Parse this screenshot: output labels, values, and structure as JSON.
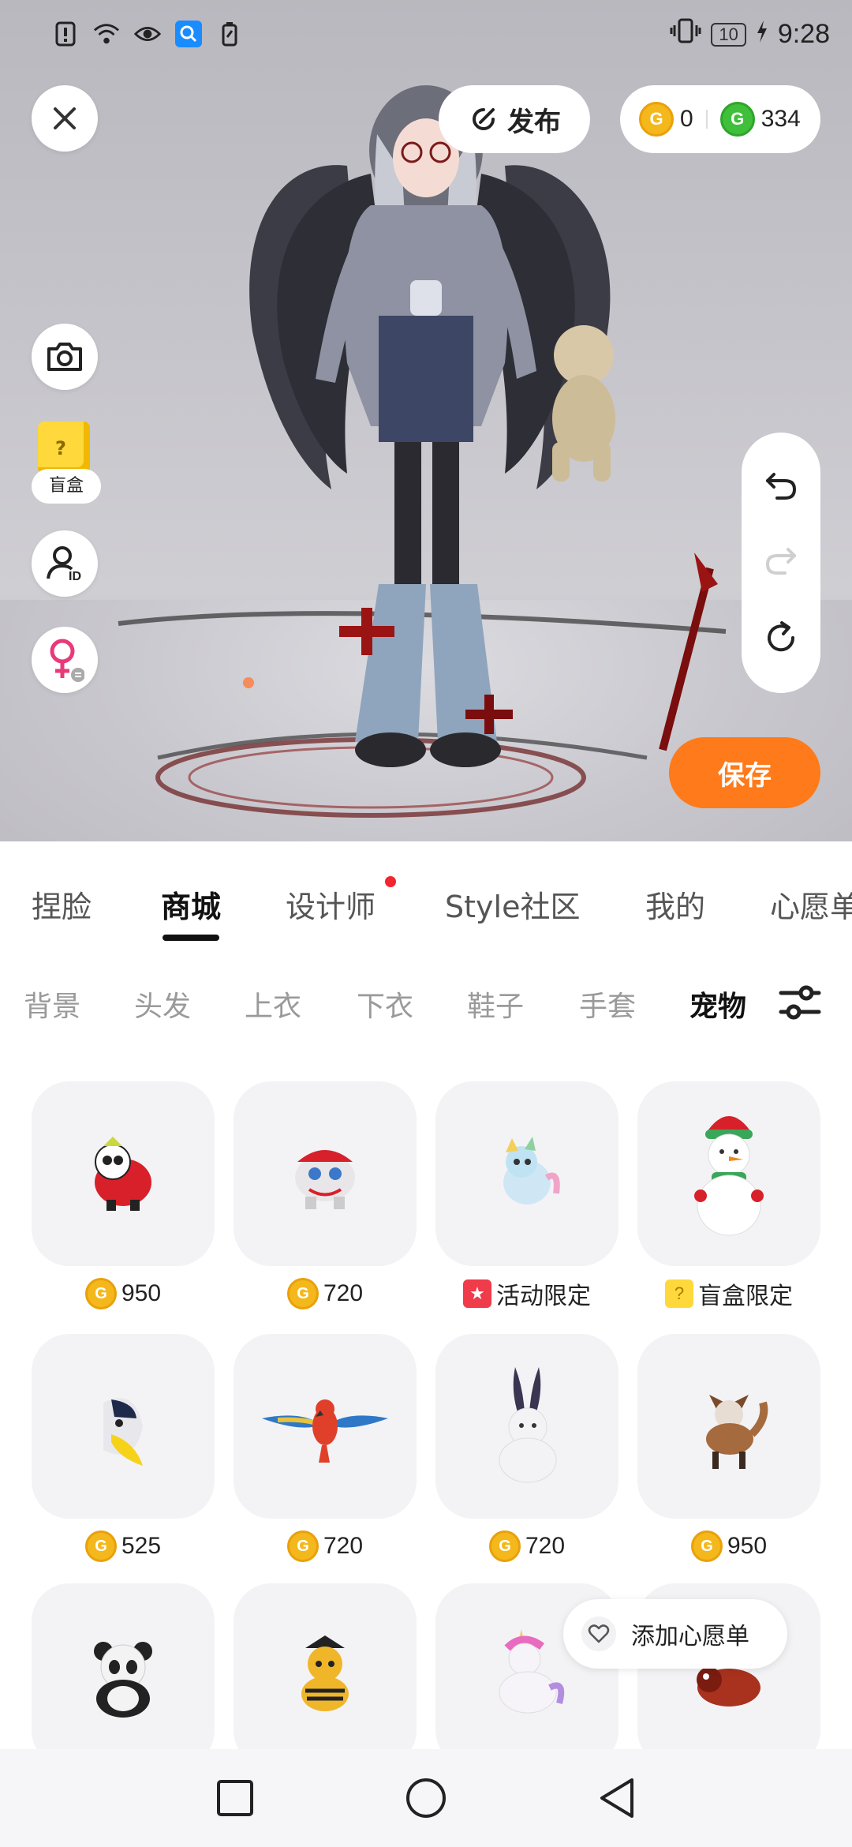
{
  "status_bar": {
    "time": "9:28",
    "battery": "10"
  },
  "top": {
    "publish_label": "发布",
    "coins_gold": "0",
    "coins_green": "334",
    "blindbox_label": "盲盒",
    "save_label": "保存"
  },
  "main_tabs": [
    {
      "label": "捏脸"
    },
    {
      "label": "商城"
    },
    {
      "label": "设计师"
    },
    {
      "label": "Style社区"
    },
    {
      "label": "我的"
    },
    {
      "label": "心愿单"
    }
  ],
  "sub_tabs": [
    {
      "label": "背景"
    },
    {
      "label": "头发"
    },
    {
      "label": "上衣"
    },
    {
      "label": "下衣"
    },
    {
      "label": "鞋子"
    },
    {
      "label": "手套"
    },
    {
      "label": "宠物"
    }
  ],
  "items": [
    {
      "pet": "panda-lion-dance",
      "price_type": "coin",
      "price": "950"
    },
    {
      "pet": "lion-dance-cat",
      "price_type": "coin",
      "price": "720"
    },
    {
      "pet": "pastel-dragon",
      "price_type": "event",
      "price": "活动限定"
    },
    {
      "pet": "snowman",
      "price_type": "blindbox",
      "price": "盲盒限定"
    },
    {
      "pet": "fish",
      "price_type": "coin",
      "price": "525"
    },
    {
      "pet": "parrot",
      "price_type": "coin",
      "price": "720"
    },
    {
      "pet": "rabbit",
      "price_type": "coin",
      "price": "720"
    },
    {
      "pet": "fox",
      "price_type": "coin",
      "price": "950"
    },
    {
      "pet": "panda",
      "price_type": "none",
      "price": ""
    },
    {
      "pet": "bee-cat",
      "price_type": "none",
      "price": ""
    },
    {
      "pet": "unicorn",
      "price_type": "none",
      "price": ""
    },
    {
      "pet": "red-panda",
      "price_type": "none",
      "price": ""
    }
  ],
  "wishlist_label": "添加心愿单",
  "colors": {
    "accent_orange": "#ff7a1a",
    "coin_gold": "#f4b81c",
    "coin_green": "#3fbf3a",
    "badge_red": "#f2262e"
  }
}
